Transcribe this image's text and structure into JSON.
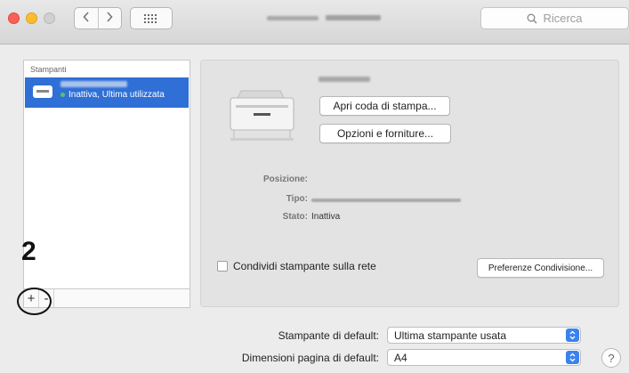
{
  "toolbar": {
    "back_icon": "chevron-left",
    "forward_icon": "chevron-right",
    "grid_icon": "show-all-grid",
    "search_placeholder": "Ricerca"
  },
  "sidebar": {
    "header": "Stampanti",
    "items": [
      {
        "status": "Inattiva, Ultima utilizzata",
        "status_color": "#59c26a",
        "selected": true
      }
    ],
    "add_label": "+",
    "remove_label": "-"
  },
  "callout": {
    "number": "2"
  },
  "detail": {
    "open_queue_label": "Apri coda di stampa...",
    "options_label": "Opzioni e forniture...",
    "location_label": "Posizione:",
    "type_label": "Tipo:",
    "status_label": "Stato:",
    "status_value": "Inattiva",
    "share_label": "Condividi stampante sulla rete",
    "share_checked": false,
    "share_prefs_label": "Preferenze Condivisione..."
  },
  "defaults": {
    "printer_label": "Stampante di default:",
    "printer_value": "Ultima stampante usata",
    "paper_label": "Dimensioni pagina di default:",
    "paper_value": "A4"
  },
  "help_label": "?",
  "colors": {
    "accent": "#2f6fd6",
    "stepper": "#3b82ed"
  }
}
